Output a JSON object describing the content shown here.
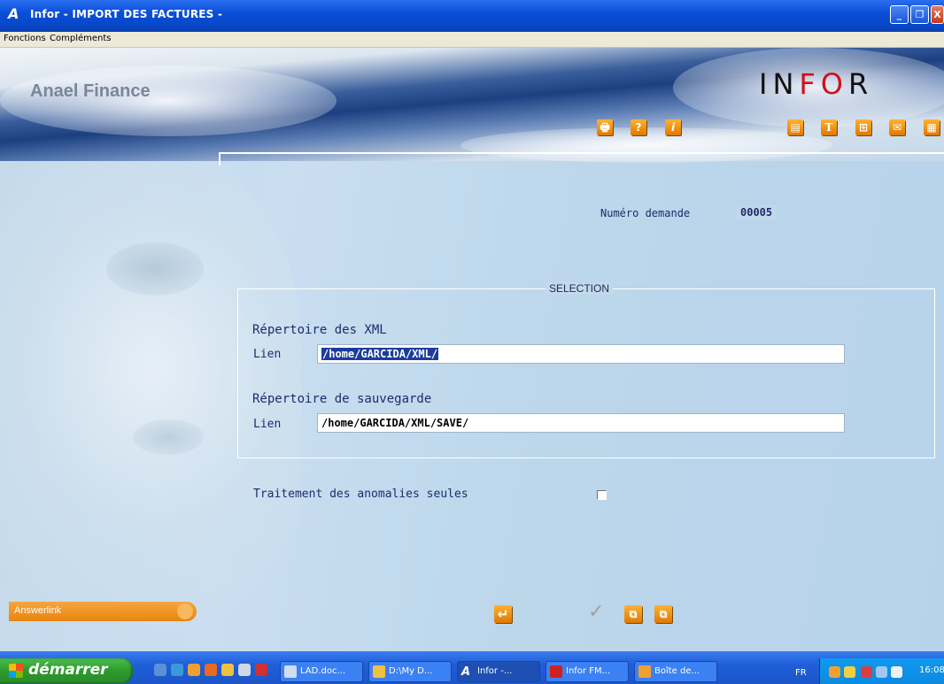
{
  "window": {
    "app_glyph": "A",
    "title": "Infor  -  IMPORT DES FACTURES  -",
    "minimize_label": "_",
    "maximize_label": "❐",
    "close_label": "X"
  },
  "menu": {
    "items": [
      "Fonctions",
      "Compléments"
    ]
  },
  "banner": {
    "brand": "Anael Finance",
    "logo": {
      "left": "IN",
      "middle": "FO",
      "right": "R"
    },
    "toolbar_left": [
      {
        "icon": "printer-icon",
        "glyph": "🖶"
      },
      {
        "icon": "help-icon",
        "glyph": "?"
      },
      {
        "icon": "info-icon",
        "glyph": "i"
      }
    ],
    "toolbar_right": [
      {
        "icon": "document-icon",
        "glyph": "▤"
      },
      {
        "icon": "text-icon",
        "glyph": "T"
      },
      {
        "icon": "grid-icon",
        "glyph": "⊞"
      },
      {
        "icon": "mail-icon",
        "glyph": "✉"
      },
      {
        "icon": "globe-icon",
        "glyph": "▦"
      }
    ]
  },
  "form": {
    "request_label": "Numéro demande",
    "request_value": "00005",
    "selection_legend": "SELECTION",
    "xml_section_title": "Répertoire des XML",
    "xml_link_label": "Lien",
    "xml_link_value": "/home/GARCIDA/XML/",
    "save_section_title": "Répertoire de sauvegarde",
    "save_link_label": "Lien",
    "save_link_value": "/home/GARCIDA/XML/SAVE/",
    "anomalies_label": "Traitement des anomalies seules",
    "anomalies_checked": false
  },
  "bottom": {
    "answerlink": "Answerlink",
    "actions": [
      {
        "icon": "enter-icon",
        "glyph": "↵"
      },
      {
        "icon": "validate-check-icon",
        "glyph": "✓"
      },
      {
        "icon": "copy-icon",
        "glyph": "⧉"
      },
      {
        "icon": "paste-icon",
        "glyph": "⧉"
      }
    ]
  },
  "taskbar": {
    "start_label": "démarrer",
    "tasks": [
      "LAD.doc...",
      "D:\\My D...",
      "Infor -...",
      "Infor FM...",
      "Boîte de..."
    ],
    "language": "FR",
    "clock": "16:08"
  },
  "colors": {
    "accent_orange": "#e8840c",
    "label_blue": "#1c2c6c",
    "title_blue": "#0a4fd8"
  }
}
